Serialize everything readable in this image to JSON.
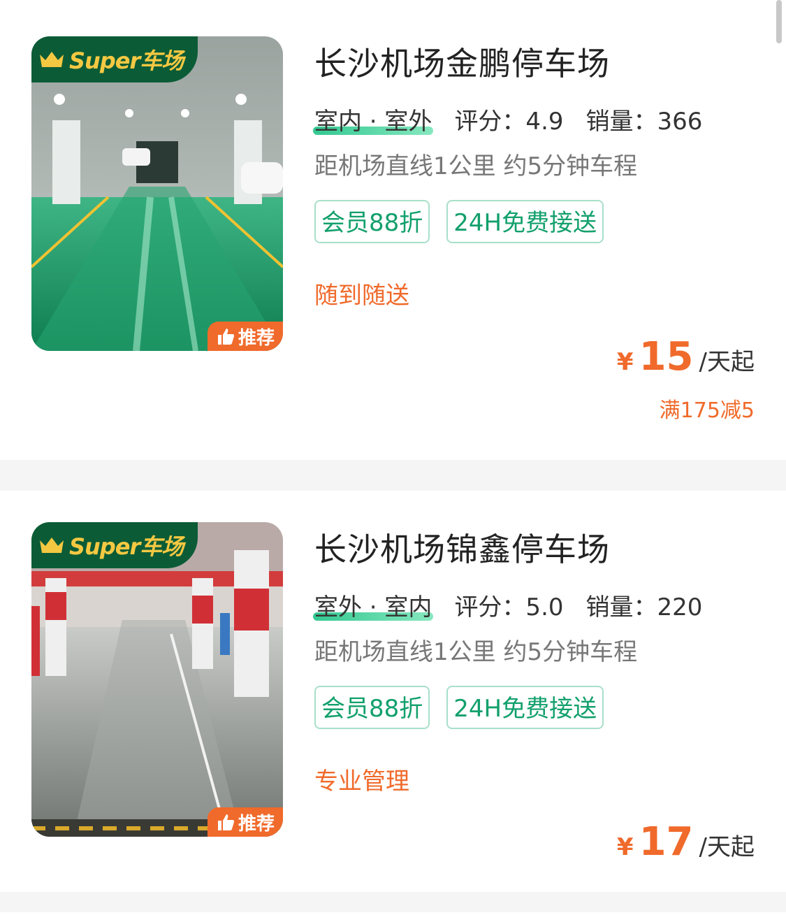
{
  "badge": {
    "super_label": "Super车场",
    "recommend_label": "推荐"
  },
  "colors": {
    "accent_orange": "#f06a2b",
    "brand_green": "#0b5c36",
    "tag_green": "#12a06c"
  },
  "lots": [
    {
      "name": "长沙机场金鹏停车场",
      "type": "室内 · 室外",
      "rating": "评分：4.9",
      "sales": "销量：366",
      "distance": "距机场直线1公里 约5分钟车程",
      "tags": [
        "会员88折",
        "24H免费接送"
      ],
      "feature": "随到随送",
      "price_currency": "¥",
      "price": "15",
      "price_unit": "/天起",
      "coupon": "满175减5",
      "photo_theme": "green-floor-garage"
    },
    {
      "name": "长沙机场锦鑫停车场",
      "type": "室外 · 室内",
      "rating": "评分：5.0",
      "sales": "销量：220",
      "distance": "距机场直线1公里 约5分钟车程",
      "tags": [
        "会员88折",
        "24H免费接送"
      ],
      "feature": "专业管理",
      "price_currency": "¥",
      "price": "17",
      "price_unit": "/天起",
      "photo_theme": "red-pillar-garage"
    }
  ]
}
